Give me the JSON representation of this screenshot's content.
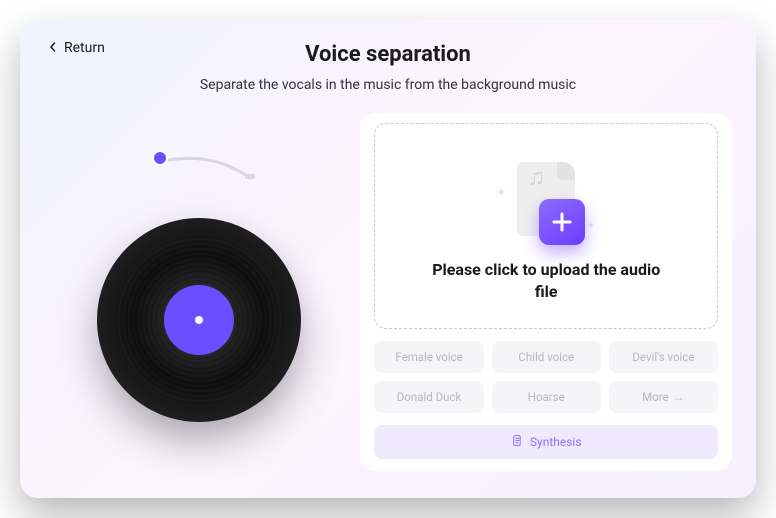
{
  "header": {
    "return_label": "Return",
    "title": "Voice separation",
    "subtitle": "Separate the vocals in the music from the background music"
  },
  "upload": {
    "prompt": "Please click to upload the audio file"
  },
  "voice_options": [
    {
      "label": "Female voice"
    },
    {
      "label": "Child voice"
    },
    {
      "label": "Devil's voice"
    },
    {
      "label": "Donald Duck"
    },
    {
      "label": "Hoarse"
    },
    {
      "label": "More",
      "has_arrow": true
    }
  ],
  "action": {
    "synthesis_label": "Synthesis"
  },
  "colors": {
    "accent": "#6b4eff",
    "synth_bg": "#efeafe",
    "synth_fg": "#8b72ff"
  }
}
